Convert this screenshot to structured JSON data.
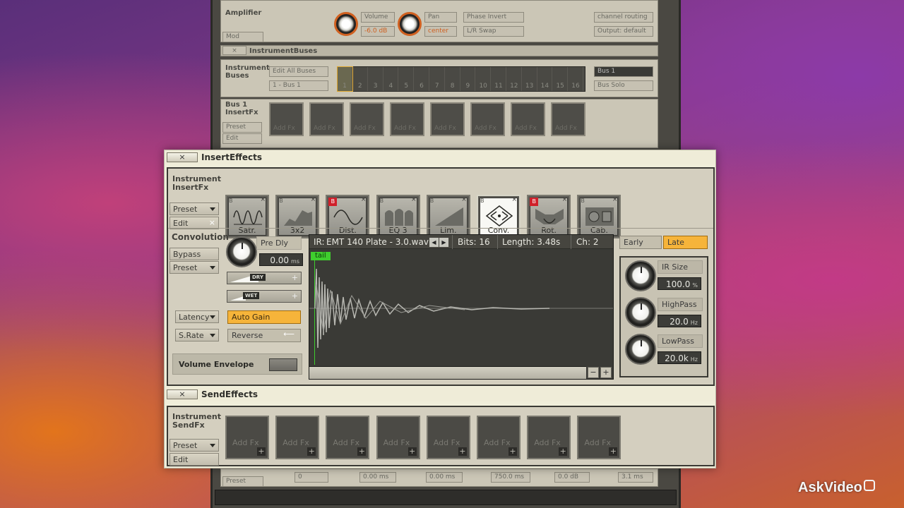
{
  "bg": {
    "amplifier": {
      "label": "Amplifier",
      "mod": "Mod",
      "volume_label": "Volume",
      "volume_value": "-6.0",
      "volume_unit": "dB",
      "pan_label": "Pan",
      "pan_value": "center",
      "phase_invert": "Phase Invert",
      "lr_swap": "L/R Swap",
      "channel_routing": "channel routing",
      "output": "Output: default"
    },
    "instrument_buses_header": "InstrumentBuses",
    "buses": {
      "label": "Instrument Buses",
      "edit_all": "Edit All Buses",
      "bus_select": "1 - Bus 1",
      "numbers": [
        "1",
        "2",
        "3",
        "4",
        "5",
        "6",
        "7",
        "8",
        "9",
        "10",
        "11",
        "12",
        "13",
        "14",
        "15",
        "16"
      ],
      "bus_name": "Bus 1",
      "bus_solo": "Bus Solo"
    },
    "bus_insert": {
      "label": "Bus 1 InsertFx",
      "preset": "Preset",
      "edit": "Edit",
      "slot_text": "Add Fx"
    },
    "bottom": {
      "preset": "Preset",
      "values": [
        "0",
        "0.00 ms",
        "0.00 ms",
        "750.0 ms",
        "0.0 dB",
        "3.1 ms"
      ]
    }
  },
  "insert": {
    "title": "InsertEffects",
    "close": "×",
    "sidebar_label": "Instrument InsertFx",
    "preset": "Preset",
    "edit": "Edit",
    "slots": [
      {
        "name": "Satr.",
        "icon": "saturator-wave-icon",
        "red": false
      },
      {
        "name": "3x2",
        "icon": "eq-curve-icon",
        "red": false
      },
      {
        "name": "Dist.",
        "icon": "distortion-wave-icon",
        "red": true
      },
      {
        "name": "EQ 3",
        "icon": "eq-bands-icon",
        "red": false
      },
      {
        "name": "Lim.",
        "icon": "limiter-ramp-icon",
        "red": false
      },
      {
        "name": "Conv.",
        "icon": "convolution-icon",
        "red": false
      },
      {
        "name": "Rot.",
        "icon": "rotator-icon",
        "red": true
      },
      {
        "name": "Cab.",
        "icon": "cabinet-icon",
        "red": false
      }
    ],
    "slot_b": "B",
    "convolution": {
      "title": "Convolution",
      "bypass": "Bypass",
      "preset": "Preset",
      "pre_dly_label": "Pre Dly",
      "pre_dly_value": "0.00",
      "pre_dly_unit": "ms",
      "dry": "DRY",
      "wet": "WET",
      "latency": "Latency",
      "srate": "S.Rate",
      "auto_gain": "Auto Gain",
      "reverse": "Reverse",
      "volume_envelope": "Volume Envelope",
      "ir_label": "IR:",
      "ir_name": "EMT 140 Plate - 3.0.wav",
      "bits": "Bits: 16",
      "length": "Length: 3.48s",
      "channels": "Ch: 2",
      "tail": "tail",
      "early": "Early",
      "late": "Late",
      "ir_size_label": "IR Size",
      "ir_size_value": "100.0",
      "ir_size_unit": "%",
      "highpass_label": "HighPass",
      "highpass_value": "20.0",
      "highpass_unit": "Hz",
      "lowpass_label": "LowPass",
      "lowpass_value": "20.0k",
      "lowpass_unit": "Hz",
      "zoom_minus": "−",
      "zoom_plus": "+"
    }
  },
  "send": {
    "title": "SendEffects",
    "close": "×",
    "sidebar_label": "Instrument SendFx",
    "preset": "Preset",
    "edit": "Edit",
    "slot_text": "Add Fx",
    "slot_count": 8
  },
  "watermark": "AskVideo",
  "colors": {
    "accent_orange": "#f6b43a",
    "tail_green": "#3fce2e",
    "panel_beige": "#d4cfbf"
  }
}
